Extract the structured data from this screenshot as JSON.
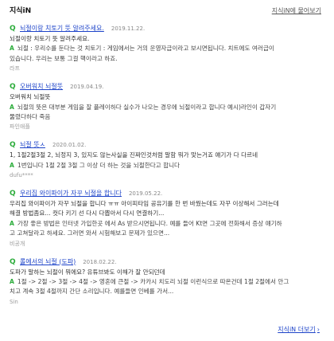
{
  "header": {
    "title": "지식iN",
    "more_link": "지식iN에 물어보기"
  },
  "items": [
    {
      "title": "뇌절이랑 치토기 뜻 알려주세요.",
      "date": "2019.11.22.",
      "question": "뇌절이랑 치토기 뜻 알려주세요.",
      "answer_lines": [
        "뇌절 : 우리수를 둔다는 것 치토기 : 게임에서는 거의 운영자급이라고 보시면됩니다. 치트에도 여러급이",
        "있습니다. 우리는 보통 그걸 핵이라고 하죠."
      ],
      "author": "라프"
    },
    {
      "title": "오버워치 뇌절뜻",
      "date": "2019.04.19.",
      "question": "오버워치 뇌절뜻",
      "answer_lines": [
        "뇌절의 뜻은 대부분 게임을 잘 플레이하다 실수가 나오는 경우에 뇌절이라고 합니다 예시)라인이 갑자기",
        "뚫렸다하다 죽음"
      ],
      "author": "파인애플"
    },
    {
      "title": "뇌절 뜻ㅅ",
      "date": "2020.01.02.",
      "question": "1, 1절2절3절 2, 뇌정지 3, 있지도 않는사실을 진짜인것처럼 말함 뭐가 맞는거죠 얘기가 다 다르네",
      "answer_lines": [
        "1번입니다 1절 2절 3절 그 이상 더 하는 것을 뇌절한다고 합니다"
      ],
      "author": "dufu****"
    },
    {
      "title": "우리집 와이파이가 자꾸 뇌절을 합니다",
      "date": "2019.05.22.",
      "question": "우리집 와이파이가 자꾸 뇌절을 합니다 ㅠㅠ 아이피타임 공유기를 한 번 바꿨는데도 자꾸 이상해서 그러는데",
      "question_lines": [
        "우리집 와이파이가 자꾸 뇌절을 합니다 ㅠㅠ 아이피타임 공유기를 한 번 바꿨는데도 자꾸 이상해서 그러는데",
        "해결 방법좀요... 컷다 키기 선 다시 다뽑아서 다시 연결하기..."
      ],
      "answer_lines": [
        "가장 좋은 방법은 인터넷 가입한곳 에서 As 받으시면됩니다. 예를 들어 Kt면 그곳에 전화해서 증상 얘기하",
        "고 고쳐달라고 하세요. 그러면 와서 시험해보고 문제가 있으면..."
      ],
      "author": "비공개"
    },
    {
      "title": "롤에서의 뇌절 (도파)",
      "date": "2018.02.22.",
      "question": "도파가 말하는 뇌절이 뭐에요? 유튜브봐도 이해가 잘 안되던데",
      "answer_lines": [
        "1절 -> 2절 -> 3절 -> 4절 -> 영혼에 큰절 -> 카카시 치도리 뇌절 이런식으로 따온건데 1절 2절에서 안그",
        "치고 계속 3절 4절까지 간단 소리입니다. 예를들면 인베를 가서..."
      ],
      "author": "Sin"
    }
  ],
  "footer": {
    "more": "지식iN 더보기",
    "arrow": "›"
  }
}
